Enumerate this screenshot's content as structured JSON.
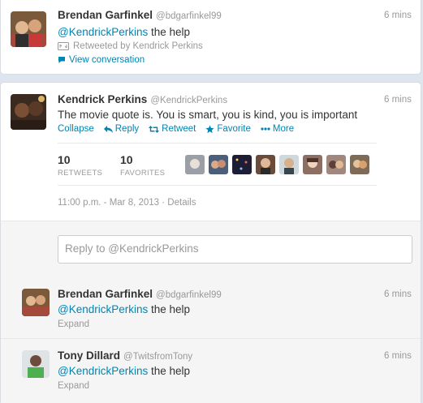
{
  "tweet1": {
    "name": "Brendan Garfinkel",
    "handle": "@bdgarfinkel99",
    "time": "6 mins",
    "mention": "@KendrickPerkins",
    "text_rest": " the help",
    "retweeted_by": "Retweeted by Kendrick Perkins",
    "view_conversation": "View conversation"
  },
  "tweet2": {
    "name": "Kendrick Perkins",
    "handle": "@KendrickPerkins",
    "time": "6 mins",
    "text": "The movie quote is. You is smart, you is kind, you is important",
    "actions": {
      "collapse": "Collapse",
      "reply": "Reply",
      "retweet": "Retweet",
      "favorite": "Favorite",
      "more": "More"
    },
    "retweets_count": "10",
    "retweets_label": "RETWEETS",
    "favorites_count": "10",
    "favorites_label": "FAVORITES",
    "timestamp": "11:00 p.m. - Mar 8, 2013",
    "details": "· Details"
  },
  "reply_box": {
    "placeholder": "Reply to @KendrickPerkins"
  },
  "replies": [
    {
      "name": "Brendan Garfinkel",
      "handle": "@bdgarfinkel99",
      "time": "6 mins",
      "mention": "@KendrickPerkins",
      "text_rest": " the help",
      "expand": "Expand"
    },
    {
      "name": "Tony Dillard",
      "handle": "@TwitsfromTony",
      "time": "6 mins",
      "mention": "@KendrickPerkins",
      "text_rest": " the help",
      "expand": "Expand"
    }
  ],
  "colors": {
    "link": "#0084b4",
    "muted": "#999999",
    "page_bg": "#dde6ee"
  }
}
